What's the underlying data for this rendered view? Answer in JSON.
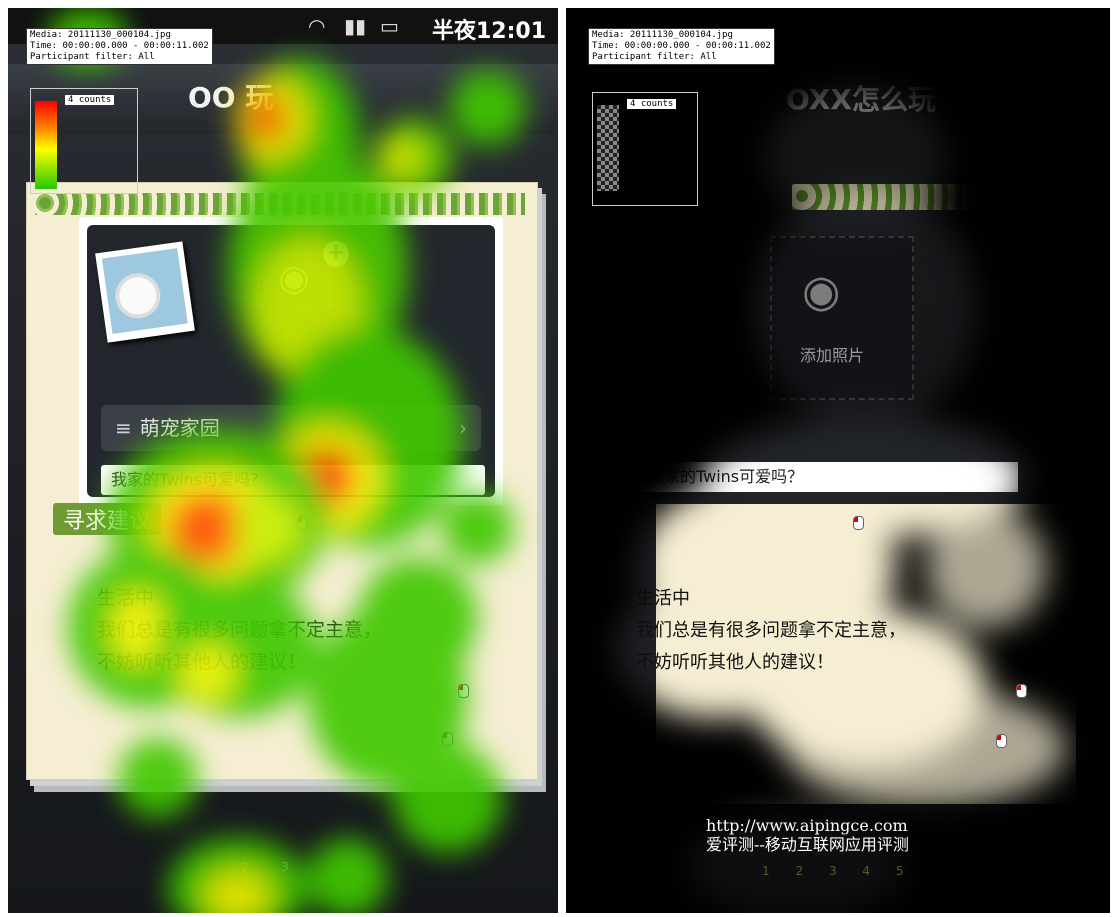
{
  "info": {
    "media": "Media: 20111130_000104.jpg",
    "time": "Time: 00:00:00.000 - 00:00:11.002",
    "filter": "Participant filter: All"
  },
  "legend": {
    "label": "4 counts"
  },
  "left": {
    "statusbar": {
      "wifi_icon": "wifi-icon",
      "signal_icon": "signal-icon",
      "battery_icon": "battery-icon",
      "time": "半夜12:01"
    },
    "title": "OO     玩",
    "category": {
      "icon": "≡",
      "label": "萌宠家园",
      "chevron": "›"
    },
    "input": "我家的Twins可爱吗？",
    "section_title": "寻求建议",
    "body": [
      "生活中",
      "我们总是有很多问题拿不定主意，",
      "不妨听听其他人的建议！"
    ],
    "page_indicators": [
      "2",
      "3"
    ]
  },
  "right": {
    "title": "OXX怎么玩",
    "add_photo": "添加照片",
    "input": "我家的Twins可爱吗？",
    "body": [
      "生活中",
      "我们总是有很多问题拿不定主意，",
      "不妨听听其他人的建议！"
    ],
    "watermark_url": "http://www.aipingce.com",
    "watermark_text": "爱评测--移动互联网应用评测",
    "page_indicators": [
      "1",
      "2",
      "3",
      "4",
      "5"
    ]
  },
  "colors": {
    "heat_low": "#2ec400",
    "heat_mid": "#e8f000",
    "heat_high": "#ff2a00",
    "grass": "#6f9b33",
    "paper": "#f6eed2"
  }
}
